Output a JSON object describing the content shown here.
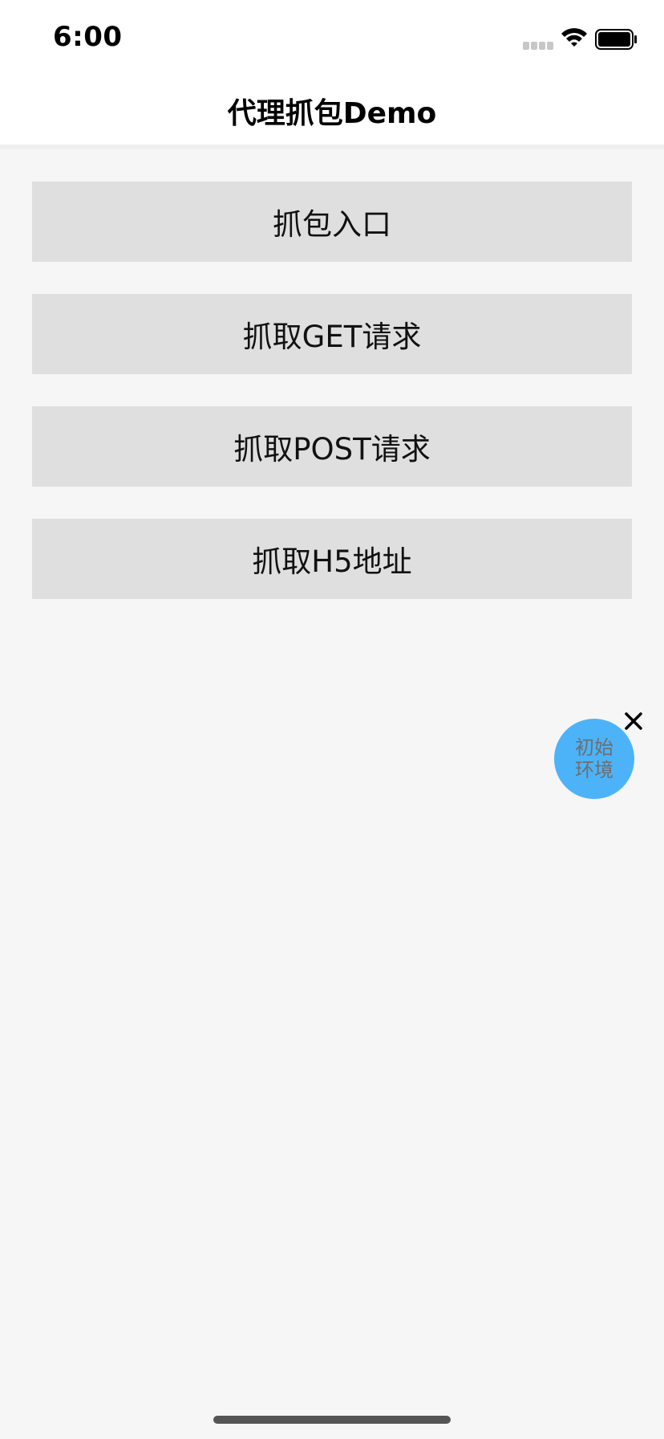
{
  "status_bar": {
    "time": "6:00",
    "signal_icon": "cellular-signal-icon",
    "wifi_icon": "wifi-icon",
    "battery_icon": "battery-icon"
  },
  "nav": {
    "title": "代理抓包Demo"
  },
  "menu": {
    "items": [
      {
        "label": "抓包入口"
      },
      {
        "label": "抓取GET请求"
      },
      {
        "label": "抓取POST请求"
      },
      {
        "label": "抓取H5地址"
      }
    ]
  },
  "floating_env": {
    "label": "初始环境",
    "close_icon": "close-icon"
  },
  "colors": {
    "background": "#f6f6f6",
    "header": "#ffffff",
    "button": "#dfdfdf",
    "floating_badge": "#4cb3f9",
    "floating_text": "#6e6e6e"
  }
}
